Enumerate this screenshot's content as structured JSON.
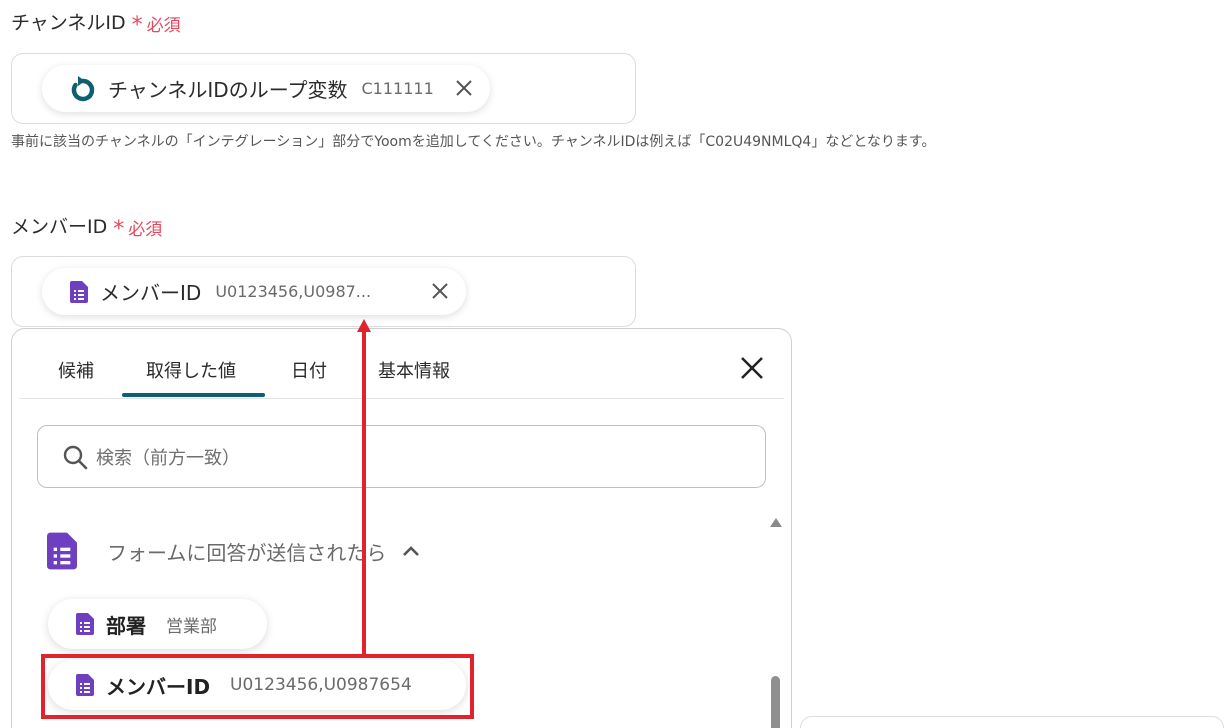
{
  "channel_field": {
    "label": "チャンネルID",
    "required": "必須",
    "chip_label": "チャンネルIDのループ変数",
    "chip_value": "C111111",
    "help_text": "事前に該当のチャンネルの「インテグレーション」部分でYoomを追加してください。チャンネルIDは例えば「C02U49NMLQ4」などとなります。"
  },
  "member_field": {
    "label": "メンバーID",
    "required": "必須",
    "chip_label": "メンバーID",
    "chip_value": "U0123456,U0987..."
  },
  "picker": {
    "tabs": [
      {
        "label": "候補"
      },
      {
        "label": "取得した値"
      },
      {
        "label": "日付"
      },
      {
        "label": "基本情報"
      }
    ],
    "active_tab": "取得した値",
    "search_placeholder": "検索（前方一致）",
    "group_title": "フォームに回答が送信されたら",
    "items": [
      {
        "label": "部署",
        "value": "営業部"
      },
      {
        "label": "メンバーID",
        "value": "U0123456,U0987654"
      }
    ]
  },
  "colors": {
    "required": "#e5495d",
    "loop_icon": "#0f5f72",
    "form_icon": "#6e3fbf",
    "tab_underline": "#0f5f72",
    "annotation": "#e0242e"
  },
  "icons": {
    "loop": "loop-icon",
    "form": "google-forms-icon",
    "close": "close-icon",
    "search": "search-icon",
    "chevron": "chevron-up-icon"
  }
}
